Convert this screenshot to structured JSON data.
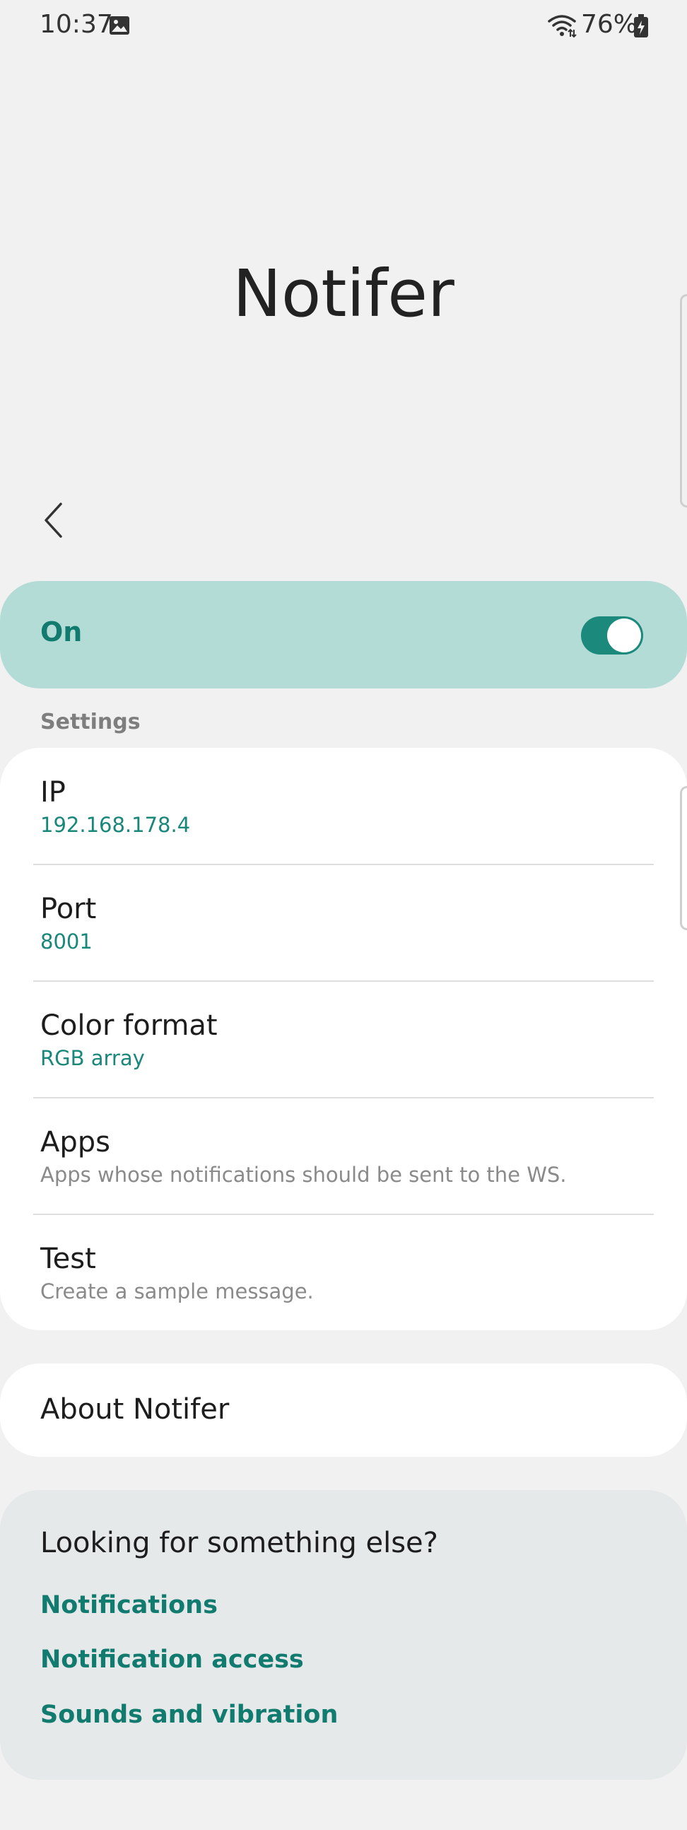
{
  "status_bar": {
    "time": "10:37",
    "battery": "76%",
    "icons": [
      "image-notification-icon",
      "wifi-icon",
      "battery-charging-icon"
    ]
  },
  "header": {
    "title": "Notifer",
    "back_icon": "chevron-left-icon"
  },
  "master_switch": {
    "label": "On",
    "state": true,
    "accent_color": "#1b8a7d",
    "background_color": "#b4dcd7"
  },
  "settings": {
    "section_label": "Settings",
    "items": [
      {
        "title": "IP",
        "subtitle": "192.168.178.4"
      },
      {
        "title": "Port",
        "subtitle": "8001"
      },
      {
        "title": "Color format",
        "subtitle": "RGB array"
      },
      {
        "title": "Apps",
        "subtitle": "Apps whose notifications should be sent to the WS."
      },
      {
        "title": "Test",
        "subtitle": "Create a sample message."
      }
    ]
  },
  "about": {
    "label": "About Notifer"
  },
  "looking": {
    "title": "Looking for something else?",
    "links": [
      "Notifications",
      "Notification access",
      "Sounds and vibration"
    ]
  },
  "colors": {
    "accent": "#1a877b",
    "background": "#f2f1f1",
    "card": "#ffffff"
  }
}
